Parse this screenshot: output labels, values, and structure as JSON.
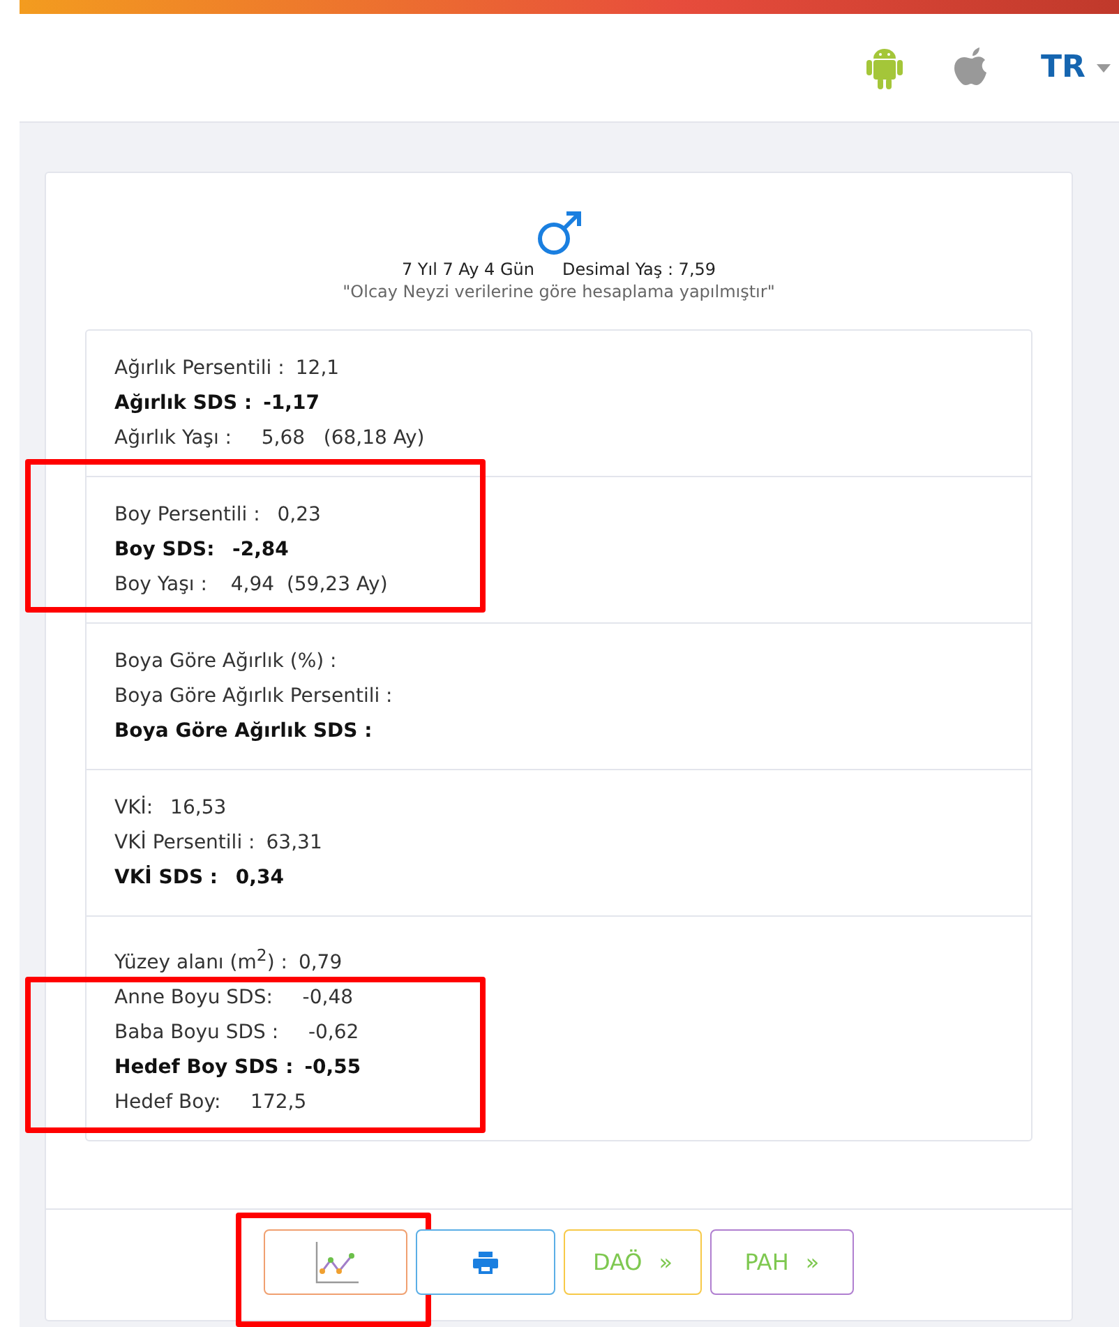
{
  "header": {
    "language": "TR"
  },
  "summary": {
    "age": "7 Yıl 7 Ay 4 Gün",
    "decimal_age": "Desimal Yaş : 7,59",
    "note": "\"Olcay Neyzi verilerine göre hesaplama yapılmıştır\""
  },
  "sections": [
    {
      "highlighted": false,
      "lines": [
        {
          "label": "Ağırlık Persentili :",
          "value": "12,1",
          "bold": false
        },
        {
          "label": "Ağırlık SDS :",
          "value": "-1,17",
          "bold": true
        },
        {
          "label": "Ağırlık Yaşı :",
          "value": "   5,68   (68,18 Ay)",
          "bold": false
        }
      ]
    },
    {
      "highlighted": true,
      "lines": [
        {
          "label": "Boy Persentili :",
          "value": " 0,23",
          "bold": false
        },
        {
          "label": "Boy SDS:",
          "value": " -2,84",
          "bold": true
        },
        {
          "label": "Boy Yaşı :",
          "value": "  4,94  (59,23 Ay)",
          "bold": false
        }
      ]
    },
    {
      "highlighted": false,
      "lines": [
        {
          "label": "Boya Göre Ağırlık (%) :",
          "bold": false
        },
        {
          "label": "Boya Göre Ağırlık Persentili :",
          "bold": false
        },
        {
          "label": "Boya Göre Ağırlık SDS :",
          "bold": true
        }
      ]
    },
    {
      "highlighted": false,
      "lines": [
        {
          "label": "VKİ:",
          "value": " 16,53",
          "bold": false
        },
        {
          "label": "VKİ Persentili :",
          "value": "63,31",
          "bold": false
        },
        {
          "label": "VKİ SDS :",
          "value": " 0,34",
          "bold": true
        }
      ]
    },
    {
      "highlighted": false,
      "lines": [
        {
          "label": "Yüzey alanı (m$^{2}$) :",
          "value": "0,79",
          "bold": false,
          "highlighted": false
        },
        {
          "label": "Anne Boyu SDS:",
          "value": "   -0,48",
          "bold": false,
          "highlighted": true
        },
        {
          "label": "Baba Boyu SDS :",
          "value": "   -0,62",
          "bold": false,
          "highlighted": true
        },
        {
          "label": "Hedef Boy SDS :",
          "value": "-0,55",
          "bold": true,
          "highlighted": true
        },
        {
          "label": "Hedef Boy:",
          "value": "   172,5",
          "bold": false,
          "highlighted": true
        }
      ]
    }
  ],
  "buttons": [
    {
      "kind": "chart",
      "highlighted": true
    },
    {
      "kind": "print",
      "highlighted": false
    },
    {
      "kind": "link",
      "label": "DAÖ",
      "arrow": "»",
      "highlighted": false
    },
    {
      "kind": "link",
      "label": "PAH",
      "arrow": "»",
      "highlighted": false
    }
  ]
}
